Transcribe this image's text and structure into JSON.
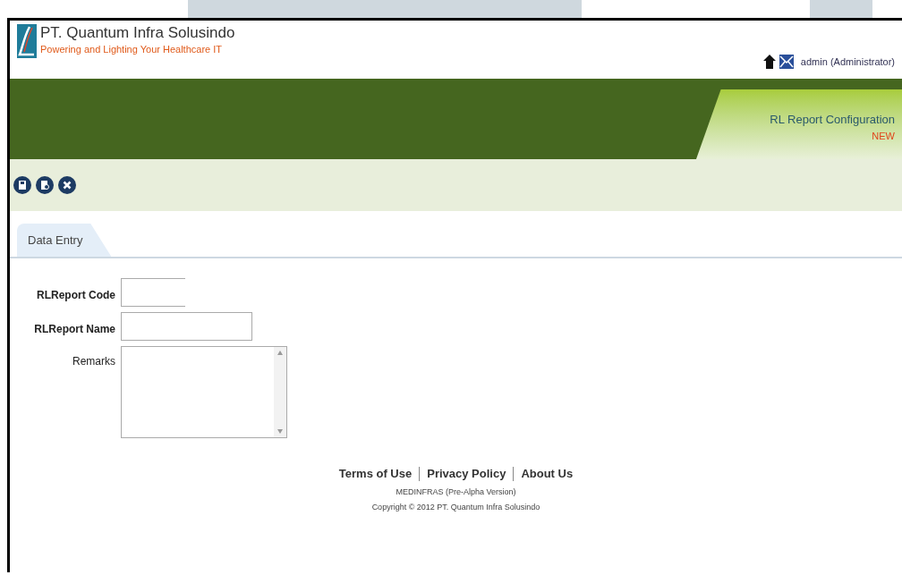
{
  "header": {
    "company": "PT. Quantum Infra Solusindo",
    "tagline": "Powering and Lighting Your Healthcare IT",
    "user": "admin (Administrator)"
  },
  "page_title": {
    "title": "RL Report Configuration",
    "mode": "NEW"
  },
  "tabs": [
    {
      "label": "Data Entry",
      "selected": true
    }
  ],
  "form": [
    {
      "label": "RLReport Code",
      "kind": "short",
      "bold": true
    },
    {
      "label": "RLReport Name",
      "kind": "text",
      "bold": true
    },
    {
      "label": "Remarks",
      "kind": "textarea",
      "bold": false
    }
  ],
  "footer": {
    "links": [
      "Terms of Use",
      "Privacy Policy",
      "About Us"
    ],
    "version": "MEDINFRAS (Pre-Alpha Version)",
    "copyright": "Copyright © 2012 PT. Quantum Infra Solusindo"
  }
}
